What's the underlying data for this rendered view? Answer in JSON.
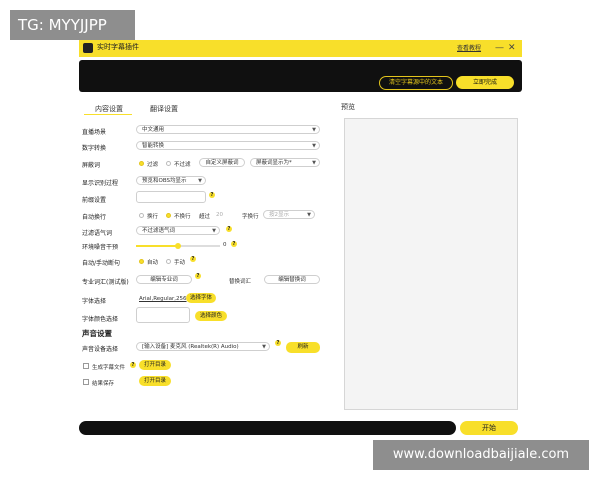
{
  "watermark_top": "TG: MYYJJPP",
  "watermark_bottom": "www.downloadbaijiale.com",
  "window": {
    "title": "实时字幕插件",
    "help_link": "查看教程",
    "minimize": "—",
    "close": "✕"
  },
  "banner": {
    "clear_button": "清空字幕源中的文本",
    "convert_button": "立即完成"
  },
  "tabs": [
    {
      "label": "内容设置",
      "active": true
    },
    {
      "label": "翻译设置",
      "active": false
    }
  ],
  "preview": {
    "label": "预览"
  },
  "settings": {
    "scene": {
      "label": "直播场景",
      "value": "中文通用"
    },
    "number": {
      "label": "数字转换",
      "value": "智能转换"
    },
    "block": {
      "label": "屏蔽词",
      "opt1": "过滤",
      "opt2": "不过滤",
      "custom_button": "自定义屏蔽词",
      "display_value": "屏蔽词显示为*"
    },
    "process": {
      "label": "显示识别过程",
      "value": "预览和OBS均显示"
    },
    "prefix": {
      "label": "前缀设置"
    },
    "wrap": {
      "label": "自动换行",
      "opt1": "换行",
      "opt2": "不换行",
      "exceed": "超过",
      "count": "20",
      "chars_wrap": "字换行",
      "lines": "按2显示"
    },
    "filler": {
      "label": "过滤语气词",
      "value": "不过滤语气词"
    },
    "noise": {
      "label": "环境噪音干预",
      "value": "0"
    },
    "segment": {
      "label": "自动/手动断句",
      "opt1": "自动",
      "opt2": "手动"
    },
    "vocab": {
      "label": "专业词汇(测试版)",
      "edit_button": "编辑专业词",
      "replace_label": "替换词汇",
      "replace_button": "编辑替换词"
    },
    "font": {
      "label": "字体选择",
      "value": "Arial,Regular,256",
      "button": "选择字体"
    },
    "font_color": {
      "label": "字体颜色选择",
      "button": "选择颜色"
    }
  },
  "audio": {
    "section_title": "声音设置",
    "device_label": "声音设备选择",
    "device_value": "[输入设备] 麦克风 (Realtek(R) Audio)",
    "refresh_button": "刷新"
  },
  "outputs": {
    "subtitle_file": {
      "label": "生成字幕文件",
      "button": "打开目录"
    },
    "result_save": {
      "label": "结果保存",
      "button": "打开目录"
    }
  },
  "start_button": "开始",
  "colors": {
    "accent": "#f8df2a",
    "dark": "#101010"
  }
}
